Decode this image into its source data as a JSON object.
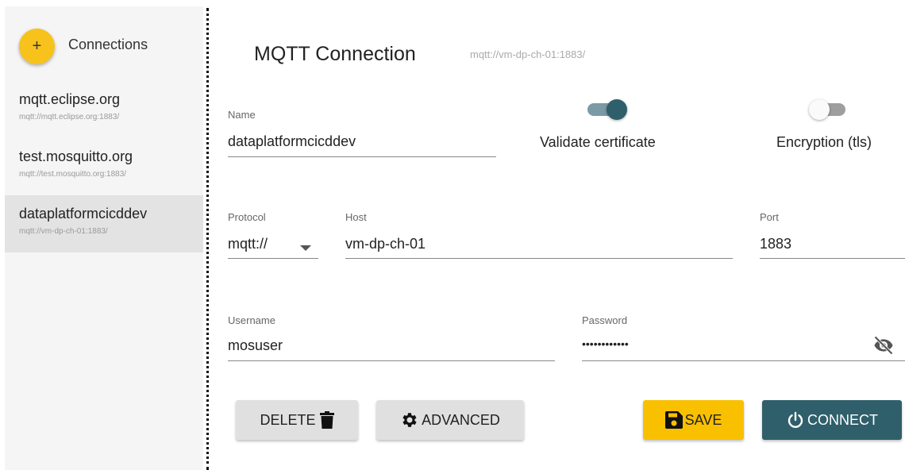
{
  "sidebar": {
    "title": "Connections",
    "add_icon": "+",
    "items": [
      {
        "name": "mqtt.eclipse.org",
        "url": "mqtt://mqtt.eclipse.org:1883/"
      },
      {
        "name": "test.mosquitto.org",
        "url": "mqtt://test.mosquitto.org:1883/"
      },
      {
        "name": "dataplatformcicddev",
        "url": "mqtt://vm-dp-ch-01:1883/"
      }
    ],
    "selected_index": 2
  },
  "header": {
    "title": "MQTT Connection",
    "url": "mqtt://vm-dp-ch-01:1883/"
  },
  "form": {
    "name": {
      "label": "Name",
      "value": "dataplatformcicddev"
    },
    "validate_certificate": {
      "label": "Validate certificate",
      "checked": true
    },
    "encryption": {
      "label": "Encryption (tls)",
      "checked": false
    },
    "protocol": {
      "label": "Protocol",
      "value": "mqtt://"
    },
    "host": {
      "label": "Host",
      "value": "vm-dp-ch-01"
    },
    "port": {
      "label": "Port",
      "value": "1883"
    },
    "username": {
      "label": "Username",
      "value": "mosuser"
    },
    "password": {
      "label": "Password",
      "value": "••••••••••••"
    }
  },
  "buttons": {
    "delete": "DELETE",
    "advanced": "ADVANCED",
    "save": "SAVE",
    "connect": "CONNECT"
  },
  "colors": {
    "accent_yellow": "#f9c000",
    "primary_teal": "#2f5f6b"
  }
}
